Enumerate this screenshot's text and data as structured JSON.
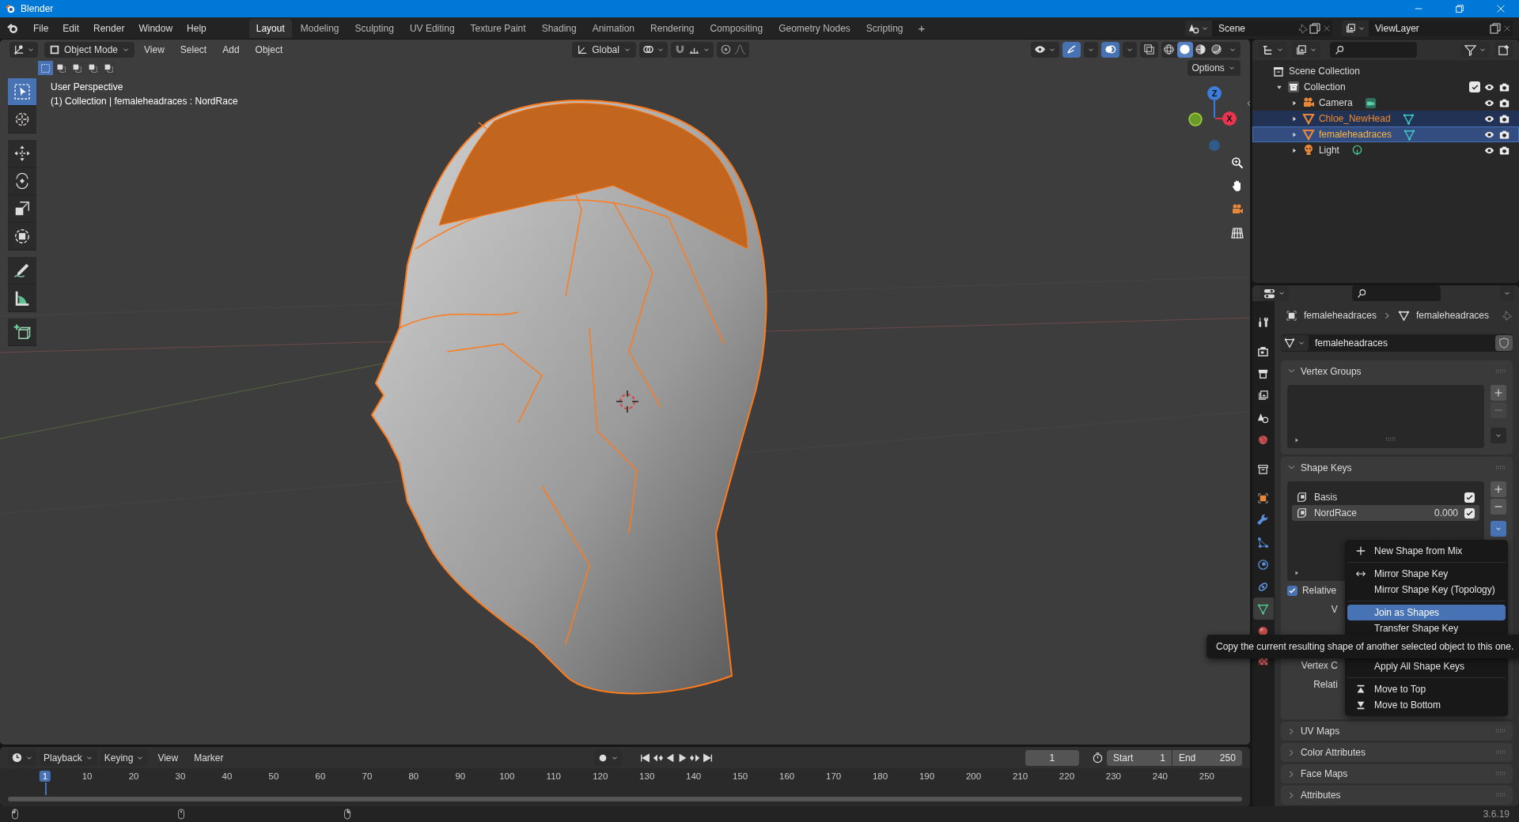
{
  "window": {
    "title": "Blender"
  },
  "topbar": {
    "menus": [
      "File",
      "Edit",
      "Render",
      "Window",
      "Help"
    ],
    "workspaces": [
      {
        "label": "Layout",
        "selected": true
      },
      {
        "label": "Modeling",
        "selected": false
      },
      {
        "label": "Sculpting",
        "selected": false
      },
      {
        "label": "UV Editing",
        "selected": false
      },
      {
        "label": "Texture Paint",
        "selected": false
      },
      {
        "label": "Shading",
        "selected": false
      },
      {
        "label": "Animation",
        "selected": false
      },
      {
        "label": "Rendering",
        "selected": false
      },
      {
        "label": "Compositing",
        "selected": false
      },
      {
        "label": "Geometry Nodes",
        "selected": false
      },
      {
        "label": "Scripting",
        "selected": false
      }
    ],
    "add_workspace": "+",
    "scene": "Scene",
    "view_layer": "ViewLayer"
  },
  "viewport": {
    "mode": "Object Mode",
    "menus": [
      "View",
      "Select",
      "Add",
      "Object"
    ],
    "orientation": "Global",
    "select_modes": [
      {
        "selected": true
      },
      {
        "selected": false
      },
      {
        "selected": false
      },
      {
        "selected": false
      },
      {
        "selected": false
      }
    ],
    "shading": [
      {
        "kind": "wireframe",
        "selected": false
      },
      {
        "kind": "solid",
        "selected": true
      },
      {
        "kind": "material",
        "selected": false
      },
      {
        "kind": "rendered",
        "selected": false
      }
    ],
    "options": "Options",
    "info": [
      "User Perspective",
      "(1) Collection | femaleheadraces : NordRace"
    ],
    "tools": [
      {
        "kind": "select",
        "selected": true
      },
      {
        "kind": "cursor",
        "selected": false
      },
      {
        "kind": "move",
        "selected": false
      },
      {
        "kind": "rotate",
        "selected": false
      },
      {
        "kind": "scale",
        "selected": false
      },
      {
        "kind": "transform",
        "selected": false
      },
      {
        "kind": "annotate",
        "selected": false
      },
      {
        "kind": "measure",
        "selected": false
      },
      {
        "kind": "add_cube",
        "selected": false
      }
    ],
    "gizmo": {
      "z": "Z",
      "x": "X"
    }
  },
  "timeline": {
    "menus": [
      "Playback",
      "Keying",
      "View",
      "Marker"
    ],
    "current_frame": "1",
    "start_label": "Start",
    "start": "1",
    "end_label": "End",
    "end": "250",
    "ruler": [
      {
        "label": "1",
        "selected": true
      },
      {
        "label": "10",
        "selected": false
      },
      {
        "label": "20",
        "selected": false
      },
      {
        "label": "30",
        "selected": false
      },
      {
        "label": "40",
        "selected": false
      },
      {
        "label": "50",
        "selected": false
      },
      {
        "label": "60",
        "selected": false
      },
      {
        "label": "70",
        "selected": false
      },
      {
        "label": "80",
        "selected": false
      },
      {
        "label": "90",
        "selected": false
      },
      {
        "label": "100",
        "selected": false
      },
      {
        "label": "110",
        "selected": false
      },
      {
        "label": "120",
        "selected": false
      },
      {
        "label": "130",
        "selected": false
      },
      {
        "label": "140",
        "selected": false
      },
      {
        "label": "150",
        "selected": false
      },
      {
        "label": "160",
        "selected": false
      },
      {
        "label": "170",
        "selected": false
      },
      {
        "label": "180",
        "selected": false
      },
      {
        "label": "190",
        "selected": false
      },
      {
        "label": "200",
        "selected": false
      },
      {
        "label": "210",
        "selected": false
      },
      {
        "label": "220",
        "selected": false
      },
      {
        "label": "230",
        "selected": false
      },
      {
        "label": "240",
        "selected": false
      },
      {
        "label": "250",
        "selected": false
      }
    ]
  },
  "outliner": {
    "items": [
      {
        "label": "Scene Collection",
        "kind": "scene_collection",
        "children": [
          {
            "label": "Collection",
            "kind": "collection",
            "expanded": true,
            "checked": true,
            "children": [
              {
                "label": "Camera",
                "kind": "camera",
                "expanded": false,
                "selected": false,
                "active": false
              },
              {
                "label": "Chloe_NewHead",
                "kind": "mesh",
                "expanded": false,
                "selected": true,
                "active": false
              },
              {
                "label": "femaleheadraces",
                "kind": "mesh",
                "expanded": false,
                "selected": true,
                "active": true
              },
              {
                "label": "Light",
                "kind": "light",
                "expanded": false,
                "selected": false,
                "active": false
              }
            ]
          }
        ]
      }
    ]
  },
  "properties": {
    "tabs": [
      {
        "kind": "tool",
        "selected": false
      },
      {
        "kind": "render",
        "selected": false
      },
      {
        "kind": "output",
        "selected": false
      },
      {
        "kind": "view_layer",
        "selected": false
      },
      {
        "kind": "scene",
        "selected": false
      },
      {
        "kind": "world",
        "selected": false
      },
      {
        "kind": "collection",
        "selected": false
      },
      {
        "kind": "object",
        "selected": false
      },
      {
        "kind": "modifiers",
        "selected": false
      },
      {
        "kind": "particles",
        "selected": false
      },
      {
        "kind": "physics",
        "selected": false
      },
      {
        "kind": "constraints",
        "selected": false
      },
      {
        "kind": "data",
        "selected": true
      },
      {
        "kind": "material",
        "selected": false
      },
      {
        "kind": "texture",
        "selected": false
      }
    ],
    "breadcrumb": [
      "femaleheadraces",
      "femaleheadraces"
    ],
    "datablock": "femaleheadraces",
    "vertex_groups": {
      "title": "Vertex Groups",
      "expanded": true
    },
    "shape_keys": {
      "title": "Shape Keys",
      "expanded": true,
      "keys": [
        {
          "name": "Basis",
          "checked": true,
          "selected": false
        },
        {
          "name": "NordRace",
          "value": "0.000",
          "checked": true,
          "selected": true
        }
      ],
      "relative": {
        "label": "Relative",
        "checked": true
      },
      "covered_labels": [
        "V",
        "Vertex C",
        "Relati"
      ]
    },
    "collapsed_panels": [
      {
        "title": "UV Maps",
        "expanded": false
      },
      {
        "title": "Color Attributes",
        "expanded": false
      },
      {
        "title": "Face Maps",
        "expanded": false
      },
      {
        "title": "Attributes",
        "expanded": false
      }
    ]
  },
  "context_menu": {
    "items": [
      {
        "kind": "add",
        "label": "New Shape from Mix",
        "selected": false
      },
      {
        "kind": "separator"
      },
      {
        "kind": "mirror",
        "label": "Mirror Shape Key",
        "selected": false
      },
      {
        "kind": "plain",
        "label": "Mirror Shape Key (Topology)",
        "selected": false
      },
      {
        "kind": "separator"
      },
      {
        "kind": "plain",
        "label": "Join as Shapes",
        "selected": true
      },
      {
        "kind": "plain",
        "label": "Transfer Shape Key",
        "selected": false
      },
      {
        "kind": "separator"
      },
      {
        "kind": "plain",
        "label": "Apply All Shape Keys",
        "selected": false
      },
      {
        "kind": "separator"
      },
      {
        "kind": "top",
        "label": "Move to Top",
        "selected": false
      },
      {
        "kind": "bottom",
        "label": "Move to Bottom",
        "selected": false
      }
    ]
  },
  "tooltip": "Copy the current resulting shape of another selected object to this one.",
  "status_bar": {
    "version": "3.6.19"
  }
}
